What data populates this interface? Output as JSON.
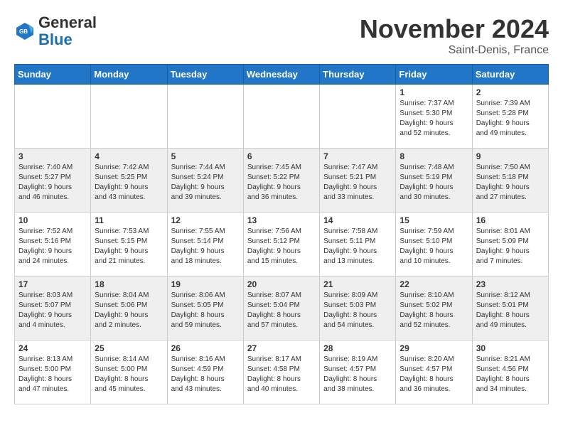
{
  "header": {
    "logo_line1": "General",
    "logo_line2": "Blue",
    "month": "November 2024",
    "location": "Saint-Denis, France"
  },
  "weekdays": [
    "Sunday",
    "Monday",
    "Tuesday",
    "Wednesday",
    "Thursday",
    "Friday",
    "Saturday"
  ],
  "weeks": [
    [
      {
        "day": "",
        "info": ""
      },
      {
        "day": "",
        "info": ""
      },
      {
        "day": "",
        "info": ""
      },
      {
        "day": "",
        "info": ""
      },
      {
        "day": "",
        "info": ""
      },
      {
        "day": "1",
        "info": "Sunrise: 7:37 AM\nSunset: 5:30 PM\nDaylight: 9 hours\nand 52 minutes."
      },
      {
        "day": "2",
        "info": "Sunrise: 7:39 AM\nSunset: 5:28 PM\nDaylight: 9 hours\nand 49 minutes."
      }
    ],
    [
      {
        "day": "3",
        "info": "Sunrise: 7:40 AM\nSunset: 5:27 PM\nDaylight: 9 hours\nand 46 minutes."
      },
      {
        "day": "4",
        "info": "Sunrise: 7:42 AM\nSunset: 5:25 PM\nDaylight: 9 hours\nand 43 minutes."
      },
      {
        "day": "5",
        "info": "Sunrise: 7:44 AM\nSunset: 5:24 PM\nDaylight: 9 hours\nand 39 minutes."
      },
      {
        "day": "6",
        "info": "Sunrise: 7:45 AM\nSunset: 5:22 PM\nDaylight: 9 hours\nand 36 minutes."
      },
      {
        "day": "7",
        "info": "Sunrise: 7:47 AM\nSunset: 5:21 PM\nDaylight: 9 hours\nand 33 minutes."
      },
      {
        "day": "8",
        "info": "Sunrise: 7:48 AM\nSunset: 5:19 PM\nDaylight: 9 hours\nand 30 minutes."
      },
      {
        "day": "9",
        "info": "Sunrise: 7:50 AM\nSunset: 5:18 PM\nDaylight: 9 hours\nand 27 minutes."
      }
    ],
    [
      {
        "day": "10",
        "info": "Sunrise: 7:52 AM\nSunset: 5:16 PM\nDaylight: 9 hours\nand 24 minutes."
      },
      {
        "day": "11",
        "info": "Sunrise: 7:53 AM\nSunset: 5:15 PM\nDaylight: 9 hours\nand 21 minutes."
      },
      {
        "day": "12",
        "info": "Sunrise: 7:55 AM\nSunset: 5:14 PM\nDaylight: 9 hours\nand 18 minutes."
      },
      {
        "day": "13",
        "info": "Sunrise: 7:56 AM\nSunset: 5:12 PM\nDaylight: 9 hours\nand 15 minutes."
      },
      {
        "day": "14",
        "info": "Sunrise: 7:58 AM\nSunset: 5:11 PM\nDaylight: 9 hours\nand 13 minutes."
      },
      {
        "day": "15",
        "info": "Sunrise: 7:59 AM\nSunset: 5:10 PM\nDaylight: 9 hours\nand 10 minutes."
      },
      {
        "day": "16",
        "info": "Sunrise: 8:01 AM\nSunset: 5:09 PM\nDaylight: 9 hours\nand 7 minutes."
      }
    ],
    [
      {
        "day": "17",
        "info": "Sunrise: 8:03 AM\nSunset: 5:07 PM\nDaylight: 9 hours\nand 4 minutes."
      },
      {
        "day": "18",
        "info": "Sunrise: 8:04 AM\nSunset: 5:06 PM\nDaylight: 9 hours\nand 2 minutes."
      },
      {
        "day": "19",
        "info": "Sunrise: 8:06 AM\nSunset: 5:05 PM\nDaylight: 8 hours\nand 59 minutes."
      },
      {
        "day": "20",
        "info": "Sunrise: 8:07 AM\nSunset: 5:04 PM\nDaylight: 8 hours\nand 57 minutes."
      },
      {
        "day": "21",
        "info": "Sunrise: 8:09 AM\nSunset: 5:03 PM\nDaylight: 8 hours\nand 54 minutes."
      },
      {
        "day": "22",
        "info": "Sunrise: 8:10 AM\nSunset: 5:02 PM\nDaylight: 8 hours\nand 52 minutes."
      },
      {
        "day": "23",
        "info": "Sunrise: 8:12 AM\nSunset: 5:01 PM\nDaylight: 8 hours\nand 49 minutes."
      }
    ],
    [
      {
        "day": "24",
        "info": "Sunrise: 8:13 AM\nSunset: 5:00 PM\nDaylight: 8 hours\nand 47 minutes."
      },
      {
        "day": "25",
        "info": "Sunrise: 8:14 AM\nSunset: 5:00 PM\nDaylight: 8 hours\nand 45 minutes."
      },
      {
        "day": "26",
        "info": "Sunrise: 8:16 AM\nSunset: 4:59 PM\nDaylight: 8 hours\nand 43 minutes."
      },
      {
        "day": "27",
        "info": "Sunrise: 8:17 AM\nSunset: 4:58 PM\nDaylight: 8 hours\nand 40 minutes."
      },
      {
        "day": "28",
        "info": "Sunrise: 8:19 AM\nSunset: 4:57 PM\nDaylight: 8 hours\nand 38 minutes."
      },
      {
        "day": "29",
        "info": "Sunrise: 8:20 AM\nSunset: 4:57 PM\nDaylight: 8 hours\nand 36 minutes."
      },
      {
        "day": "30",
        "info": "Sunrise: 8:21 AM\nSunset: 4:56 PM\nDaylight: 8 hours\nand 34 minutes."
      }
    ]
  ]
}
